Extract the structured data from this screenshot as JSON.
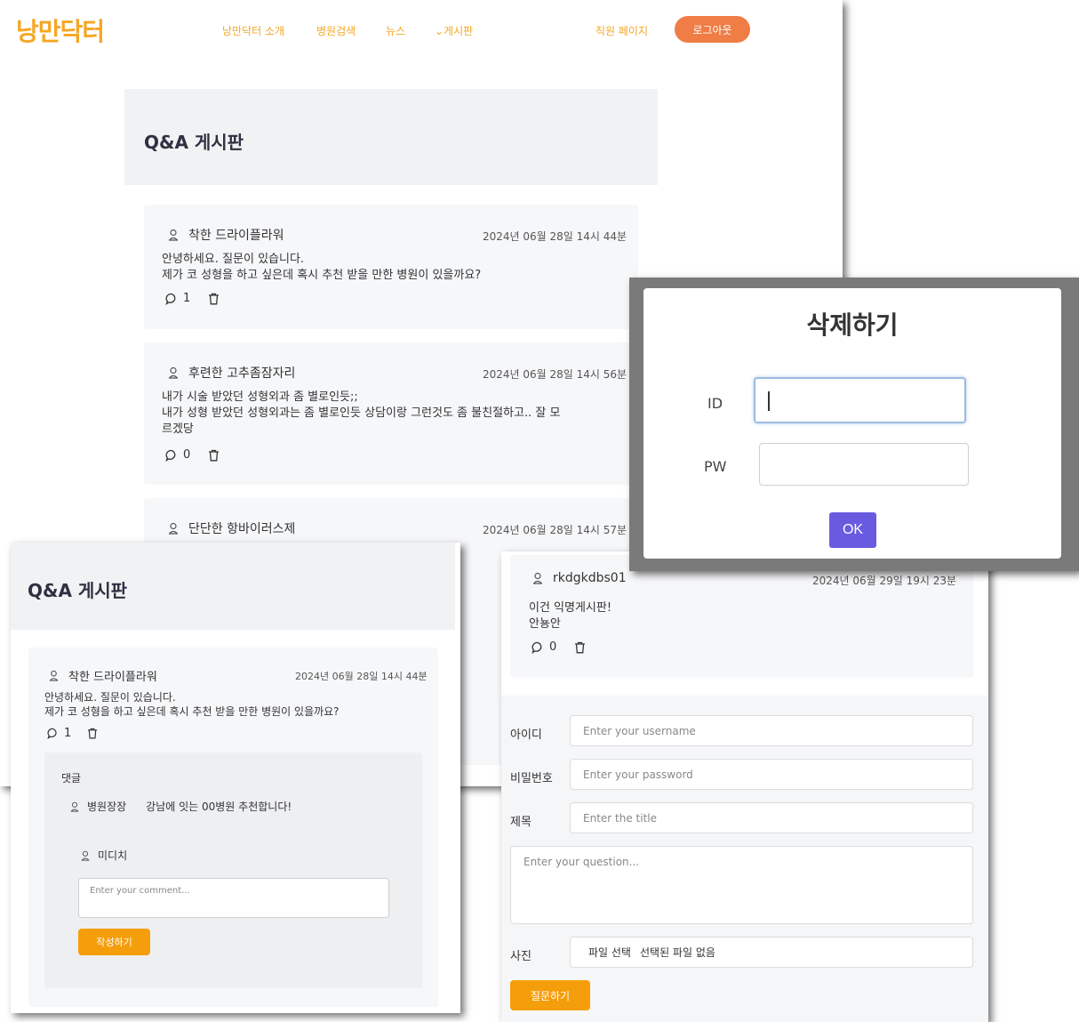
{
  "header": {
    "logo": "낭만닥터",
    "nav": [
      "낭만닥터 소개",
      "병원검색",
      "뉴스",
      "게시판"
    ],
    "staff_link": "직원 페이지",
    "logout": "로그아웃"
  },
  "board": {
    "title": "Q&A 게시판",
    "posts": [
      {
        "author": "착한 드라이플라워",
        "date": "2024년 06월 28일 14시 44분",
        "line1": "안녕하세요. 질문이 있습니다.",
        "line2": "제가 코 성형을 하고 싶은데 혹시 추천 받을 만한 병원이 있을까요?",
        "comments": "1"
      },
      {
        "author": "후련한 고추좀잠자리",
        "date": "2024년 06월 28일 14시 56분",
        "line1": "내가 시술 받았던 성형외과 좀 별로인듯;;",
        "line2": "내가 성형 받았던 성형외과는 좀 별로인듯 상담이랑 그런것도 좀 불친절하고.. 잘 모",
        "line3": "르겠당",
        "comments": "0"
      },
      {
        "author": "단단한 항바이러스제",
        "date": "2024년 06월 28일 14시 57분"
      }
    ]
  },
  "modal": {
    "title": "삭제하기",
    "id_label": "ID",
    "pw_label": "PW",
    "ok": "OK"
  },
  "comment_view": {
    "title": "Q&A 게시판",
    "post": {
      "author": "착한 드라이플라워",
      "date": "2024년 06월 28일 14시 44분",
      "line1": "안녕하세요. 질문이 있습니다.",
      "line2": "제가 코 성형을 하고 싶은데 혹시 추천 받을 만한 병원이 있을까요?",
      "comments": "1"
    },
    "comments_heading": "댓글",
    "comment": {
      "author": "병원장장",
      "text": "강남에 잇는 00병원 추천합니다!"
    },
    "writer": "미디치",
    "comment_placeholder": "Enter your comment...",
    "submit": "작성하기"
  },
  "form_view": {
    "post": {
      "author": "rkdgkdbs01",
      "date": "2024년 06월 29일 19시 23분",
      "line1": "이건 익명게시판!",
      "line2": "안뇽안",
      "comments": "0"
    },
    "id_label": "아이디",
    "id_placeholder": "Enter your username",
    "pw_label": "비밀번호",
    "pw_placeholder": "Enter your password",
    "title_label": "제목",
    "title_placeholder": "Enter the title",
    "question_placeholder": "Enter your question...",
    "photo_label": "사진",
    "file_button": "파일 선택",
    "file_status": "선택된 파일 없음",
    "submit": "질문하기"
  },
  "colors": {
    "brand": "#f5a623",
    "logout": "#ef7d45",
    "ok": "#6a5ae0",
    "submit": "#f59e0b"
  }
}
